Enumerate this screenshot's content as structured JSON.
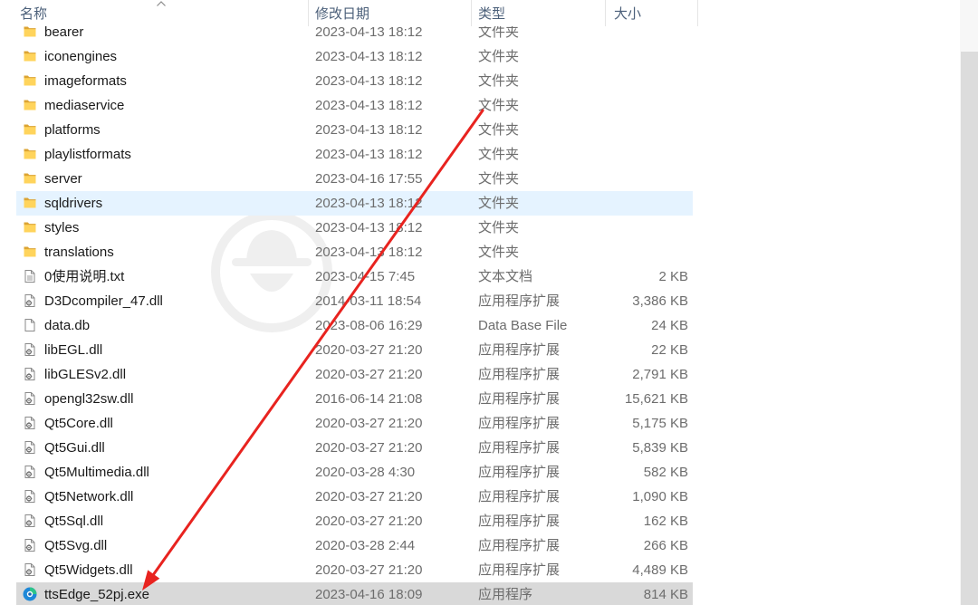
{
  "header": {
    "columns": {
      "name": "名称",
      "modified": "修改日期",
      "type": "类型",
      "size": "大小"
    },
    "sort_icon": "chevron-up-icon"
  },
  "files": [
    {
      "icon": "folder-icon",
      "name": "bearer",
      "modified": "2023-04-13 18:12",
      "type": "文件夹",
      "size": ""
    },
    {
      "icon": "folder-icon",
      "name": "iconengines",
      "modified": "2023-04-13 18:12",
      "type": "文件夹",
      "size": ""
    },
    {
      "icon": "folder-icon",
      "name": "imageformats",
      "modified": "2023-04-13 18:12",
      "type": "文件夹",
      "size": ""
    },
    {
      "icon": "folder-icon",
      "name": "mediaservice",
      "modified": "2023-04-13 18:12",
      "type": "文件夹",
      "size": ""
    },
    {
      "icon": "folder-icon",
      "name": "platforms",
      "modified": "2023-04-13 18:12",
      "type": "文件夹",
      "size": ""
    },
    {
      "icon": "folder-icon",
      "name": "playlistformats",
      "modified": "2023-04-13 18:12",
      "type": "文件夹",
      "size": ""
    },
    {
      "icon": "folder-icon",
      "name": "server",
      "modified": "2023-04-16 17:55",
      "type": "文件夹",
      "size": ""
    },
    {
      "icon": "folder-icon",
      "name": "sqldrivers",
      "modified": "2023-04-13 18:12",
      "type": "文件夹",
      "size": "",
      "hovered": true
    },
    {
      "icon": "folder-icon",
      "name": "styles",
      "modified": "2023-04-13 18:12",
      "type": "文件夹",
      "size": ""
    },
    {
      "icon": "folder-icon",
      "name": "translations",
      "modified": "2023-04-13 18:12",
      "type": "文件夹",
      "size": ""
    },
    {
      "icon": "text-file-icon",
      "name": "0使用说明.txt",
      "modified": "2023-04-15 7:45",
      "type": "文本文档",
      "size": "2 KB"
    },
    {
      "icon": "dll-file-icon",
      "name": "D3Dcompiler_47.dll",
      "modified": "2014-03-11 18:54",
      "type": "应用程序扩展",
      "size": "3,386 KB"
    },
    {
      "icon": "db-file-icon",
      "name": "data.db",
      "modified": "2023-08-06 16:29",
      "type": "Data Base File",
      "size": "24 KB"
    },
    {
      "icon": "dll-file-icon",
      "name": "libEGL.dll",
      "modified": "2020-03-27 21:20",
      "type": "应用程序扩展",
      "size": "22 KB"
    },
    {
      "icon": "dll-file-icon",
      "name": "libGLESv2.dll",
      "modified": "2020-03-27 21:20",
      "type": "应用程序扩展",
      "size": "2,791 KB"
    },
    {
      "icon": "dll-file-icon",
      "name": "opengl32sw.dll",
      "modified": "2016-06-14 21:08",
      "type": "应用程序扩展",
      "size": "15,621 KB"
    },
    {
      "icon": "dll-file-icon",
      "name": "Qt5Core.dll",
      "modified": "2020-03-27 21:20",
      "type": "应用程序扩展",
      "size": "5,175 KB"
    },
    {
      "icon": "dll-file-icon",
      "name": "Qt5Gui.dll",
      "modified": "2020-03-27 21:20",
      "type": "应用程序扩展",
      "size": "5,839 KB"
    },
    {
      "icon": "dll-file-icon",
      "name": "Qt5Multimedia.dll",
      "modified": "2020-03-28 4:30",
      "type": "应用程序扩展",
      "size": "582 KB"
    },
    {
      "icon": "dll-file-icon",
      "name": "Qt5Network.dll",
      "modified": "2020-03-27 21:20",
      "type": "应用程序扩展",
      "size": "1,090 KB"
    },
    {
      "icon": "dll-file-icon",
      "name": "Qt5Sql.dll",
      "modified": "2020-03-27 21:20",
      "type": "应用程序扩展",
      "size": "162 KB"
    },
    {
      "icon": "dll-file-icon",
      "name": "Qt5Svg.dll",
      "modified": "2020-03-28 2:44",
      "type": "应用程序扩展",
      "size": "266 KB"
    },
    {
      "icon": "dll-file-icon",
      "name": "Qt5Widgets.dll",
      "modified": "2020-03-27 21:20",
      "type": "应用程序扩展",
      "size": "4,489 KB"
    },
    {
      "icon": "exe-app-icon",
      "name": "ttsEdge_52pj.exe",
      "modified": "2023-04-16 18:09",
      "type": "应用程序",
      "size": "814 KB",
      "selected": true
    }
  ],
  "decorations": {
    "watermark_icon": "hat-logo-icon",
    "annotation_icon": "red-arrow-icon"
  },
  "colors": {
    "hover_row": "#e5f3ff",
    "selected_row": "#d9d9d9",
    "header_text": "#4c607a",
    "name_text": "#1a1a1a",
    "detail_text": "#6d6d6d",
    "scrollbar_thumb": "#dcdcdc",
    "scrollbar_track": "#f7f7f7",
    "annotation_arrow": "#e8231f",
    "watermark": "#efefef"
  }
}
